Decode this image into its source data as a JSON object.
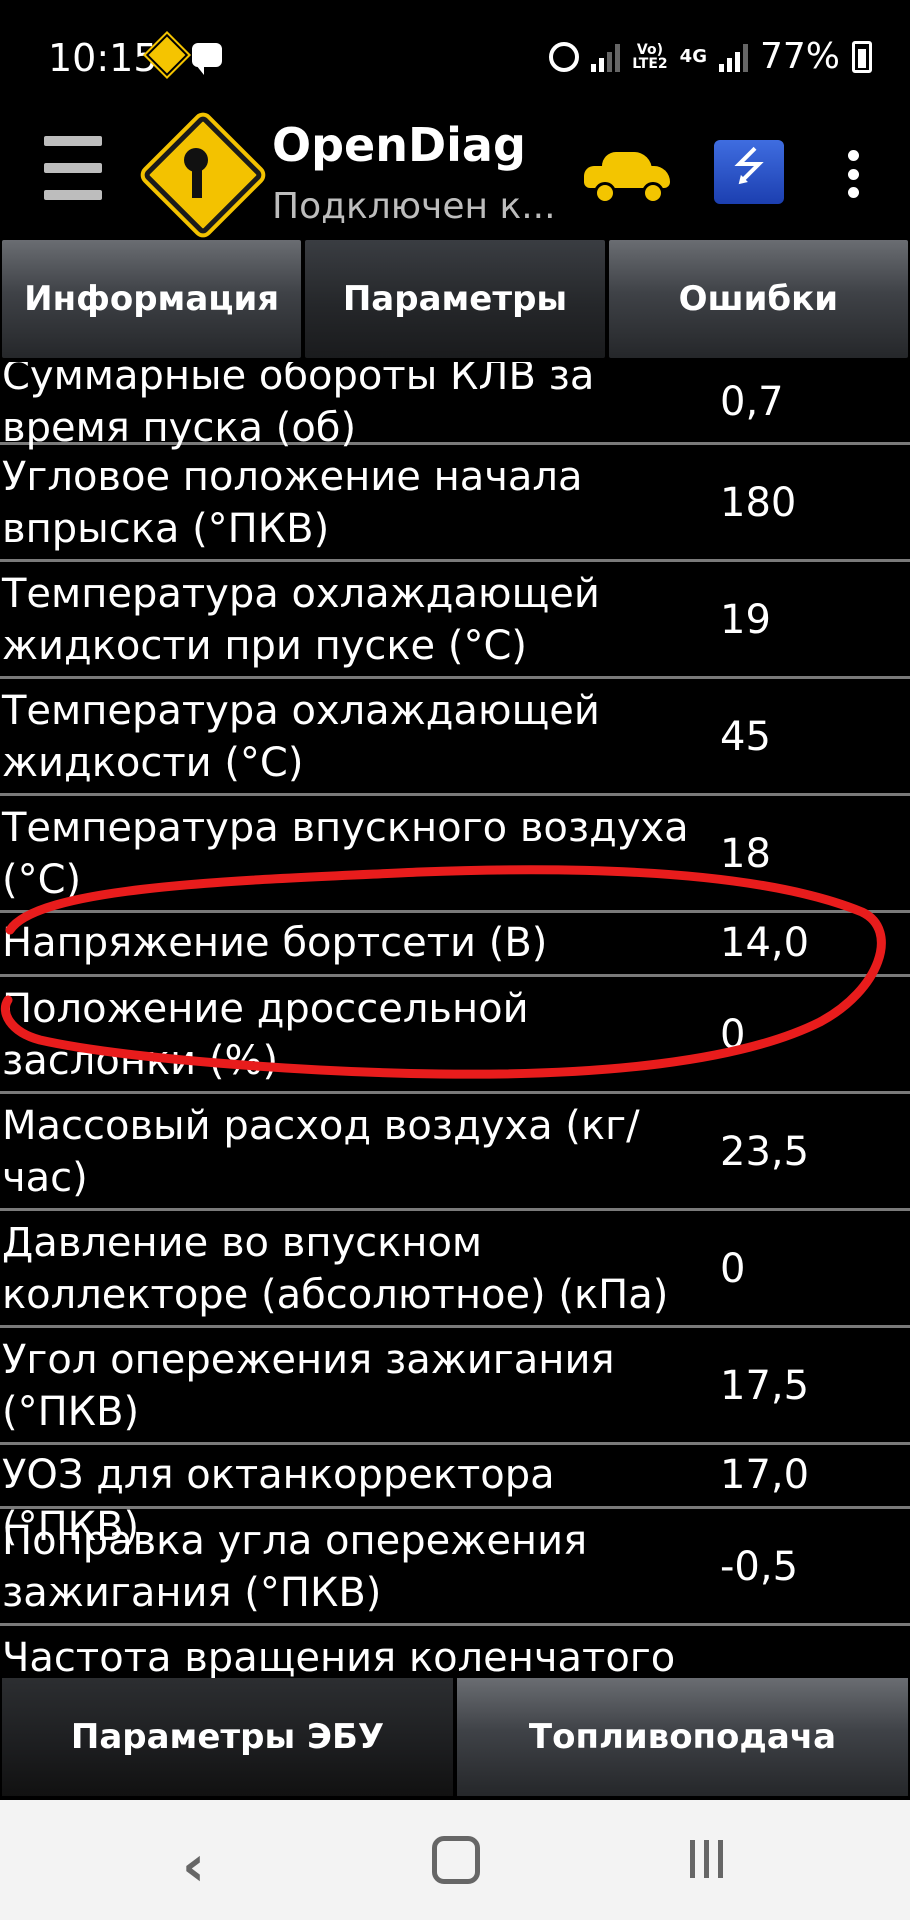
{
  "status_bar": {
    "time": "10:15",
    "network_label_top": "Vo)",
    "network_label_bottom": "LTE2",
    "network_type": "4G",
    "battery": "77%"
  },
  "app_bar": {
    "title": "OpenDiag",
    "subtitle": "Подключен к...",
    "usb_glyph": "⭍"
  },
  "tabs": [
    {
      "label": "Информация",
      "active": false
    },
    {
      "label": "Параметры",
      "active": true
    },
    {
      "label": "Ошибки",
      "active": false
    }
  ],
  "params": [
    {
      "line1": "Суммарные обороты КЛВ за",
      "line2": "время пуска (об)",
      "value": "0,7"
    },
    {
      "line1": "Угловое положение начала",
      "line2": "впрыска (°ПКВ)",
      "value": "180"
    },
    {
      "line1": "Температура охлаждающей",
      "line2": "жидкости при пуске (°С)",
      "value": "19"
    },
    {
      "line1": "Температура охлаждающей",
      "line2": "жидкости (°С)",
      "value": "45"
    },
    {
      "line1": "Температура впускного воздуха",
      "line2": "(°С)",
      "value": "18"
    },
    {
      "line1": "Напряжение бортсети (В)",
      "line2": "",
      "value": "14,0"
    },
    {
      "line1": "Положение дроссельной",
      "line2": "заслонки (%)",
      "value": "0"
    },
    {
      "line1": "Массовый расход воздуха (кг/",
      "line2": "час)",
      "value": "23,5"
    },
    {
      "line1": "Давление во впускном",
      "line2": "коллекторе (абсолютное) (кПа)",
      "value": "0"
    },
    {
      "line1": "Угол опережения зажигания",
      "line2": "(°ПКВ)",
      "value": "17,5"
    },
    {
      "line1": "УОЗ для октанкорректора (°ПКВ)",
      "line2": "",
      "value": "17,0"
    },
    {
      "line1": "Поправка угла опережения",
      "line2": "зажигания (°ПКВ)",
      "value": "-0,5"
    },
    {
      "line1": "Частота вращения коленчатого",
      "line2": "",
      "value": ""
    }
  ],
  "bottom_buttons": [
    {
      "label": "Параметры ЭБУ"
    },
    {
      "label": "Топливоподача"
    }
  ],
  "nav_bar": {
    "back_glyph": "‹"
  },
  "colors": {
    "background": "#000000",
    "annotation": "#e81c1c",
    "logo_yellow": "#f3c200",
    "usb_blue": "#2f5ad0",
    "nav_bar": "#f3f3f3"
  }
}
